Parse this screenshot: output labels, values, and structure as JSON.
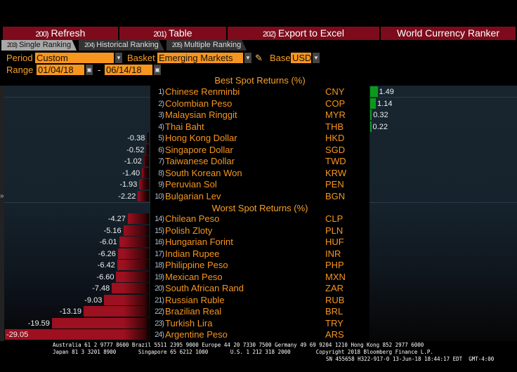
{
  "toolbar": {
    "refresh": {
      "n": "200)",
      "label": "Refresh"
    },
    "table": {
      "n": "201)",
      "label": "Table"
    },
    "export": {
      "n": "202)",
      "label": "Export to Excel"
    },
    "title": "World Currency Ranker"
  },
  "tabs": [
    {
      "n": "203)",
      "label": "Single Ranking"
    },
    {
      "n": "204)",
      "label": "Historical Ranking"
    },
    {
      "n": "205)",
      "label": "Multiple Ranking"
    }
  ],
  "controls": {
    "period_label": "Period",
    "period": "Custom",
    "basket_label": "Basket",
    "basket": "Emerging Markets",
    "base_label": "Base",
    "base": "USD",
    "range_label": "Range",
    "start": "01/04/18",
    "dash": "-",
    "end": "06/14/18"
  },
  "best_header": "Best Spot Returns (%)",
  "worst_header": "Worst Spot Returns (%)",
  "colors": {
    "positive": "#0a9a1a",
    "negative": "#9c1020",
    "accent": "#f7961e"
  },
  "best": [
    {
      "rank": "1)",
      "name": "Chinese Renminbi",
      "code": "CNY",
      "value": 1.49,
      "label": "1.49"
    },
    {
      "rank": "2)",
      "name": "Colombian Peso",
      "code": "COP",
      "value": 1.14,
      "label": "1.14"
    },
    {
      "rank": "3)",
      "name": "Malaysian Ringgit",
      "code": "MYR",
      "value": 0.32,
      "label": "0.32"
    },
    {
      "rank": "4)",
      "name": "Thai Baht",
      "code": "THB",
      "value": 0.22,
      "label": "0.22"
    },
    {
      "rank": "5)",
      "name": "Hong Kong Dollar",
      "code": "HKD",
      "value": -0.38,
      "label": "-0.38"
    },
    {
      "rank": "6)",
      "name": "Singapore Dollar",
      "code": "SGD",
      "value": -0.52,
      "label": "-0.52"
    },
    {
      "rank": "7)",
      "name": "Taiwanese Dollar",
      "code": "TWD",
      "value": -1.02,
      "label": "-1.02"
    },
    {
      "rank": "8)",
      "name": "South Korean Won",
      "code": "KRW",
      "value": -1.4,
      "label": "-1.40"
    },
    {
      "rank": "9)",
      "name": "Peruvian Sol",
      "code": "PEN",
      "value": -1.93,
      "label": "-1.93"
    },
    {
      "rank": "10)",
      "name": "Bulgarian Lev",
      "code": "BGN",
      "value": -2.22,
      "label": "-2.22"
    }
  ],
  "worst": [
    {
      "rank": "14)",
      "name": "Chilean Peso",
      "code": "CLP",
      "value": -4.27,
      "label": "-4.27"
    },
    {
      "rank": "15)",
      "name": "Polish Zloty",
      "code": "PLN",
      "value": -5.16,
      "label": "-5.16"
    },
    {
      "rank": "16)",
      "name": "Hungarian Forint",
      "code": "HUF",
      "value": -6.01,
      "label": "-6.01"
    },
    {
      "rank": "17)",
      "name": "Indian Rupee",
      "code": "INR",
      "value": -6.26,
      "label": "-6.26"
    },
    {
      "rank": "18)",
      "name": "Philippine Peso",
      "code": "PHP",
      "value": -6.42,
      "label": "-6.42"
    },
    {
      "rank": "19)",
      "name": "Mexican Peso",
      "code": "MXN",
      "value": -6.6,
      "label": "-6.60"
    },
    {
      "rank": "20)",
      "name": "South African Rand",
      "code": "ZAR",
      "value": -7.48,
      "label": "-7.48"
    },
    {
      "rank": "21)",
      "name": "Russian Ruble",
      "code": "RUB",
      "value": -9.03,
      "label": "-9.03"
    },
    {
      "rank": "22)",
      "name": "Brazilian Real",
      "code": "BRL",
      "value": -13.19,
      "label": "-13.19"
    },
    {
      "rank": "23)",
      "name": "Turkish Lira",
      "code": "TRY",
      "value": -19.59,
      "label": "-19.59"
    },
    {
      "rank": "24)",
      "name": "Argentine Peso",
      "code": "ARS",
      "value": -29.05,
      "label": "-29.05"
    }
  ],
  "footer": {
    "line1": "Australia 61 2 9777 8600 Brazil 5511 2395 9000 Europe 44 20 7330 7500 Germany 49 69 9204 1210 Hong Kong 852 2977 6000",
    "line2": "Japan 81 3 3201 8900       Singapore 65 6212 1000       U.S. 1 212 318 2000        Copyright 2018 Bloomberg Finance L.P.",
    "line3": "SN 455658 H322-917-0 13-Jun-18 18:44:17 EDT  GMT-4:00"
  }
}
